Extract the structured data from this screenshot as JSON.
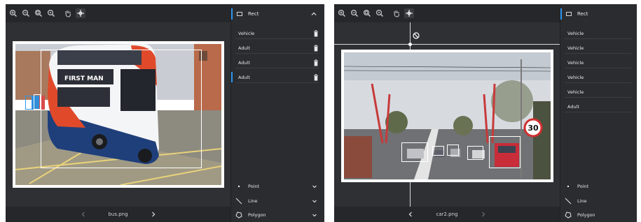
{
  "left": {
    "filename": "bus.png",
    "sidebar": {
      "header": "Rect",
      "labels": [
        "Vehicle",
        "Adult",
        "Adult",
        "Adult"
      ],
      "tools": [
        "Point",
        "Line",
        "Polygon"
      ]
    },
    "toolbar": [
      "zoom-in-icon",
      "zoom-out-icon",
      "zoom-fit-icon",
      "zoom-reset-icon",
      "hand-icon",
      "crosshair-icon"
    ],
    "bus_banner": "FIRST MAN"
  },
  "right": {
    "filename": "car2.png",
    "sidebar": {
      "header": "Rect",
      "labels": [
        "Vehicle",
        "Vehicle",
        "Vehicle",
        "Vehicle",
        "Vehicle",
        "Adult"
      ],
      "tools": [
        "Point",
        "Line",
        "Polygon"
      ]
    },
    "toolbar": [
      "zoom-in-icon",
      "zoom-out-icon",
      "zoom-fit-icon",
      "zoom-reset-icon",
      "hand-icon",
      "crosshair-icon"
    ],
    "speed_sign": "30"
  },
  "colors": {
    "panel": "#2e2f33",
    "accent": "#2c97f2",
    "text": "#e6e8ea"
  }
}
